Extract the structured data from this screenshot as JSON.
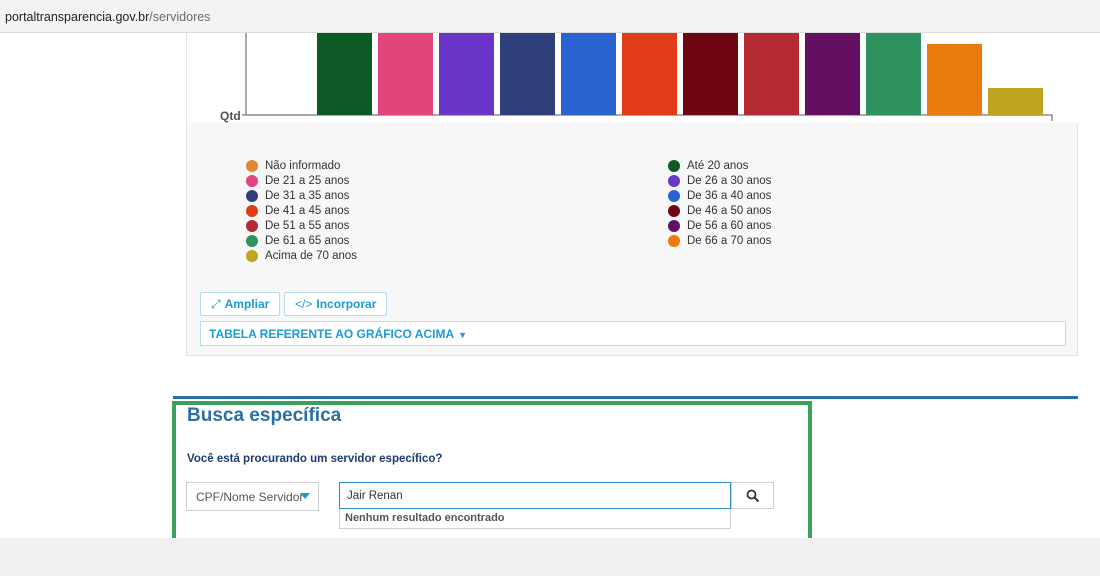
{
  "browser": {
    "url_host": "portaltransparencia.gov.br",
    "url_path": "/servidores"
  },
  "chart_data": {
    "type": "bar",
    "ylabel": "Qtd",
    "categories": [
      "Não informado",
      "Até 20 anos",
      "De 21 a 25 anos",
      "De 26 a 30 anos",
      "De 31 a 35 anos",
      "De 36 a 40 anos",
      "De 41 a 45 anos",
      "De 46 a 50 anos",
      "De 51 a 55 anos",
      "De 56 a 60 anos",
      "De 61 a 65 anos",
      "De 66 a 70 anos",
      "Acima de 70 anos"
    ],
    "values": [
      0,
      100,
      100,
      100,
      100,
      100,
      100,
      100,
      100,
      100,
      100,
      71,
      27
    ],
    "colors": [
      "#e0883a",
      "#0e5a26",
      "#e0457b",
      "#6a35c9",
      "#2f3f7a",
      "#2a63d0",
      "#e03c17",
      "#6f0712",
      "#b52a33",
      "#640f62",
      "#2f935f",
      "#ec7b0d",
      "#bfa41f"
    ],
    "note": "values relative; bars exceed visible top"
  },
  "legend": {
    "left": [
      "Não informado",
      "De 21 a 25 anos",
      "De 31 a 35 anos",
      "De 41 a 45 anos",
      "De 51 a 55 anos",
      "De 61 a 65 anos",
      "Acima de 70 anos"
    ],
    "left_colors": [
      "#e0883a",
      "#e0457b",
      "#2f3f7a",
      "#e03c17",
      "#b52a33",
      "#2f935f",
      "#bfa41f"
    ],
    "right": [
      "Até 20 anos",
      "De 26 a 30 anos",
      "De 36 a 40 anos",
      "De 46 a 50 anos",
      "De 56 a 60 anos",
      "De 66 a 70 anos"
    ],
    "right_colors": [
      "#0e5a26",
      "#6a35c9",
      "#2a63d0",
      "#6f0712",
      "#640f62",
      "#ec7b0d"
    ]
  },
  "actions": {
    "ampliar": "Ampliar",
    "incorporar": "Incorporar",
    "tabela": "TABELA REFERENTE AO GRÁFICO ACIMA"
  },
  "search": {
    "title": "Busca específica",
    "question": "Você está procurando um servidor específico?",
    "select_value": "CPF/Nome Servidor",
    "input_value": "Jair Renan",
    "no_result": "Nenhum resultado encontrado"
  }
}
